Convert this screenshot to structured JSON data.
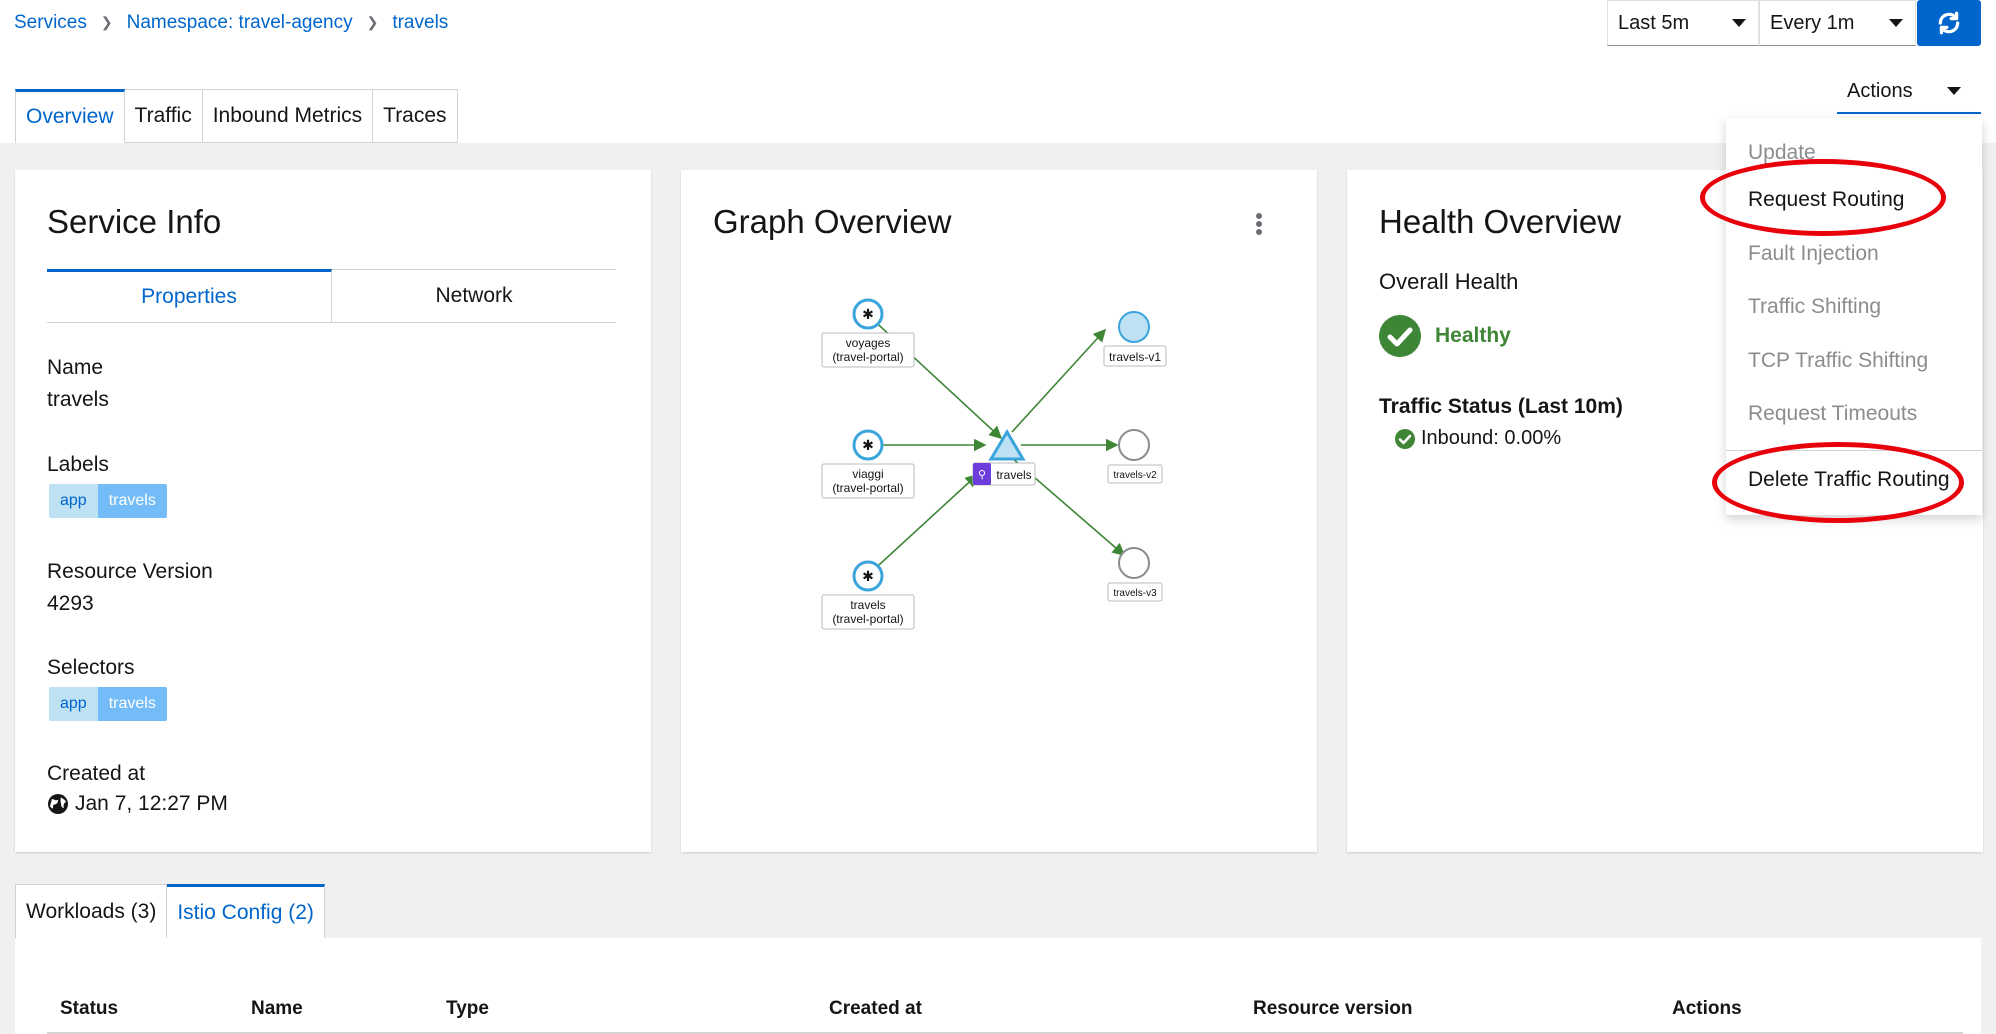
{
  "breadcrumb": [
    "Services",
    "Namespace: travel-agency",
    "travels"
  ],
  "controls": {
    "duration": "Last 5m",
    "refresh_interval": "Every 1m",
    "refresh_icon": "sync-icon",
    "actions_label": "Actions"
  },
  "tabs": [
    "Overview",
    "Traffic",
    "Inbound Metrics",
    "Traces"
  ],
  "service_info": {
    "title": "Service Info",
    "subtabs": [
      "Properties",
      "Network"
    ],
    "name_label": "Name",
    "name_value": "travels",
    "labels_label": "Labels",
    "labels": [
      {
        "key": "app",
        "value": "travels"
      }
    ],
    "resource_version_label": "Resource Version",
    "resource_version": "4293",
    "selectors_label": "Selectors",
    "selectors": [
      {
        "key": "app",
        "value": "travels"
      }
    ],
    "created_label": "Created at",
    "created_value": "Jan 7, 12:27 PM"
  },
  "graph": {
    "title": "Graph Overview",
    "nodes": {
      "voyages_line1": "voyages",
      "voyages_line2": "(travel-portal)",
      "viaggi_line1": "viaggi",
      "viaggi_line2": "(travel-portal)",
      "travels_src_line1": "travels",
      "travels_src_line2": "(travel-portal)",
      "center": "travels",
      "v1": "travels-v1",
      "v2": "travels-v2",
      "v3": "travels-v3"
    }
  },
  "health": {
    "title": "Health Overview",
    "overall_label": "Overall Health",
    "status": "Healthy",
    "traffic_label": "Traffic Status (Last 10m)",
    "inbound": "Inbound: 0.00%"
  },
  "actions_menu": {
    "items": [
      "Update",
      "Request Routing",
      "Fault Injection",
      "Traffic Shifting",
      "TCP Traffic Shifting",
      "Request Timeouts"
    ],
    "delete": "Delete Traffic Routing"
  },
  "bottom_tabs": [
    "Workloads (3)",
    "Istio Config (2)"
  ],
  "table": {
    "columns": [
      "Status",
      "Name",
      "Type",
      "Created at",
      "Resource version",
      "Actions"
    ]
  },
  "colors": {
    "link": "#0066cc",
    "healthy": "#3e8635",
    "highlight_ring": "#e8000b",
    "edge": "#3e8635"
  }
}
